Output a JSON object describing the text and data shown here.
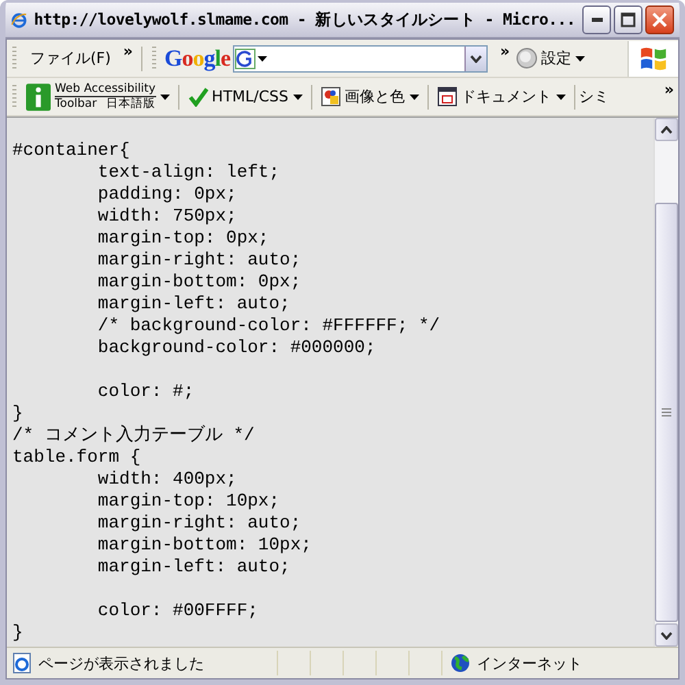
{
  "window": {
    "title": "http://lovelywolf.slmame.com - 新しいスタイルシート - Micro..."
  },
  "menu_toolbar": {
    "menu": "ファイル(F)",
    "chevron": "»"
  },
  "google_toolbar": {
    "logo": "Google",
    "chevron": "»",
    "settings": "設定"
  },
  "accessibility_toolbar": {
    "title_top": "Web Accessibility",
    "title_bottom": "Toolbar",
    "edition": "日本語版",
    "items": [
      {
        "label": "HTML/CSS",
        "kind": "check"
      },
      {
        "label": "画像と色",
        "kind": "image"
      },
      {
        "label": "ドキュメント",
        "kind": "document"
      },
      {
        "label": "シミ",
        "kind": "cut"
      }
    ],
    "chevron": "»"
  },
  "document": {
    "code": "\n#container{\n        text-align: left;\n        padding: 0px;\n        width: 750px;\n        margin-top: 0px;\n        margin-right: auto;\n        margin-bottom: 0px;\n        margin-left: auto;\n        /* background-color: #FFFFFF; */\n        background-color: #000000;\n\n        color: #;\n}\n/* コメント入力テーブル */\ntable.form {\n        width: 400px;\n        margin-top: 10px;\n        margin-right: auto;\n        margin-bottom: 10px;\n        margin-left: auto;\n\n        color: #00FFFF;\n}"
  },
  "status_bar": {
    "message": "ページが表示されました",
    "zone": "インターネット"
  }
}
